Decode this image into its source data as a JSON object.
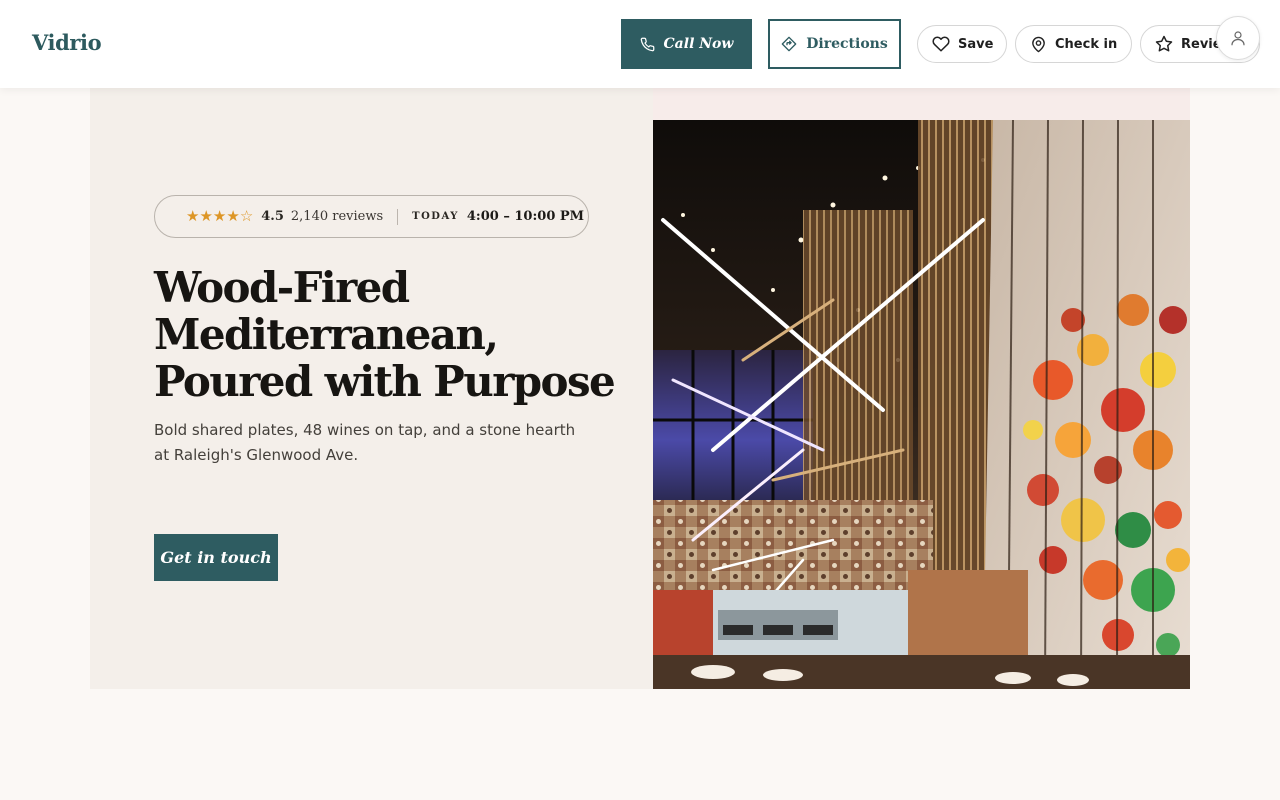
{
  "header": {
    "brand": "Vidrio",
    "call_label": "Call Now",
    "directions_label": "Directions",
    "save_label": "Save",
    "checkin_label": "Check in",
    "review_label": "Review"
  },
  "hero": {
    "rating": "4.5",
    "stars_filled": 4,
    "stars_half": 1,
    "reviews": "2,140 reviews",
    "today_label": "TODAY",
    "hours": "4:00 – 10:00 PM",
    "headline_line1": "Wood-Fired",
    "headline_line2": "Mediterranean,",
    "headline_line3": "Poured with Purpose",
    "subtext": "Bold shared plates, 48 wines on tap, and a stone hearth at Raleigh's Glenwood Ave.",
    "cta_label": "Get in touch"
  },
  "colors": {
    "accent": "#2e5c61",
    "star": "#dd9626",
    "hero_bg": "#f4efea"
  },
  "icons": {
    "call": "phone-icon",
    "directions": "directions-diamond-icon",
    "save": "heart-icon",
    "checkin": "map-pin-icon",
    "review": "star-outline-icon",
    "account": "user-icon"
  }
}
